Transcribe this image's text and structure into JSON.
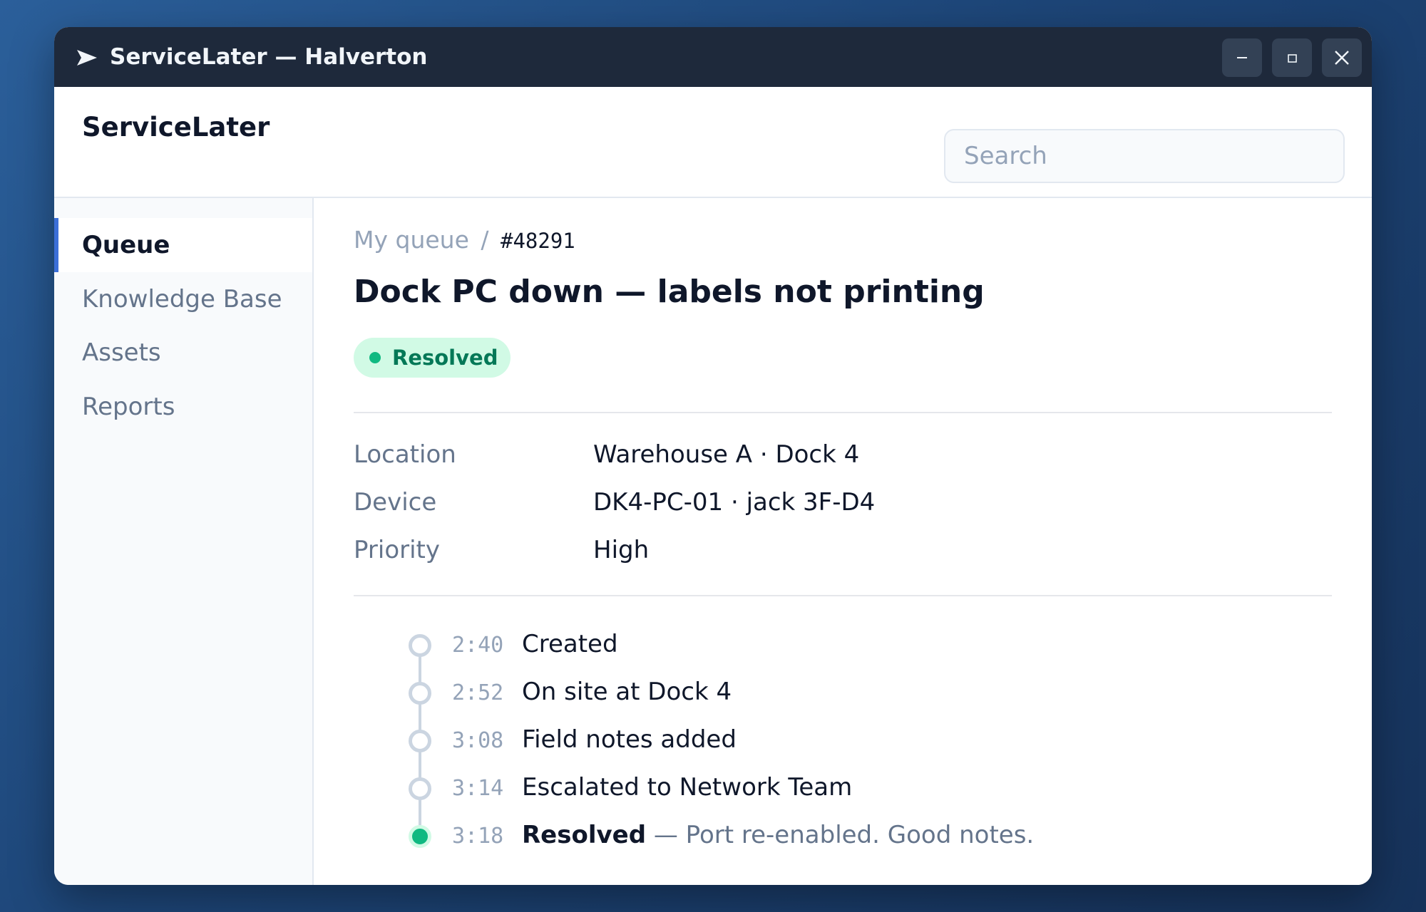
{
  "window": {
    "title": "ServiceLater — Halverton",
    "minimize_icon": "minimize-icon",
    "maximize_icon": "maximize-icon",
    "close_icon": "close-icon"
  },
  "header": {
    "brand": "ServiceLater",
    "search_placeholder": "Search"
  },
  "sidebar": {
    "items": [
      {
        "label": "Queue",
        "active": true
      },
      {
        "label": "Knowledge Base",
        "active": false
      },
      {
        "label": "Assets",
        "active": false
      },
      {
        "label": "Reports",
        "active": false
      }
    ],
    "accent_color": "#3b6fd8"
  },
  "ticket": {
    "breadcrumb_parent": "My queue",
    "breadcrumb_sep": "/",
    "id": "#48291",
    "title": "Dock PC down — labels not printing",
    "status": "Resolved",
    "status_color": "#10b981",
    "fields": [
      {
        "label": "Location",
        "value": "Warehouse A · Dock 4"
      },
      {
        "label": "Device",
        "value": "DK4-PC-01 · jack 3F-D4"
      },
      {
        "label": "Priority",
        "value": "High"
      }
    ],
    "timeline": [
      {
        "time": "2:40",
        "text": "Created",
        "done": false
      },
      {
        "time": "2:52",
        "text": "On site at Dock 4",
        "done": false
      },
      {
        "time": "3:08",
        "text": "Field notes added",
        "done": false
      },
      {
        "time": "3:14",
        "text": "Escalated to Network Team",
        "done": false
      },
      {
        "time": "3:18",
        "text": "Resolved",
        "note": " — Port re-enabled. Good notes.",
        "done": true
      }
    ]
  }
}
